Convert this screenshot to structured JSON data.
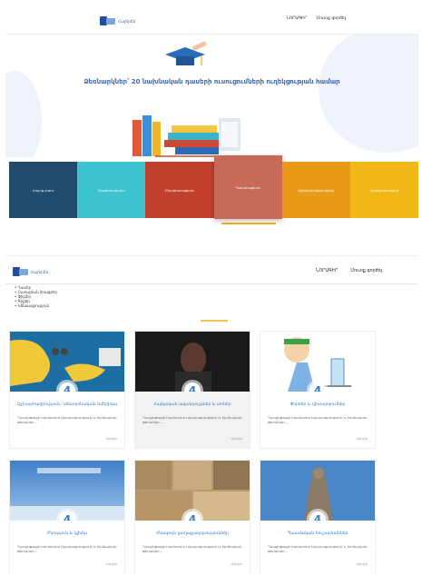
{
  "top": {
    "logo_text": "Հայերեն",
    "nav": [
      "ՆՈՐԱԳԻՐ",
      "Մուտք գործել"
    ],
    "hero_title": "Ձեռնարկներ՝ 20 նախնական դասերի ուսուցումների ուղեկցության համար",
    "categories": [
      {
        "label": "Հայոց լեզու",
        "color": "#1e4b6e"
      },
      {
        "label": "Մաթեմատիկա",
        "color": "#3cc3cf"
      },
      {
        "label": "Բնագիտություն",
        "color": "#c0402b"
      },
      {
        "label": "Պատմություն",
        "color": "#c86a58"
      },
      {
        "label": "Աշխարհագրություն",
        "color": "#e89a18"
      },
      {
        "label": "Գրականություն",
        "color": "#f1b818"
      }
    ]
  },
  "bottom": {
    "logo_text": "Հայերեն",
    "nav": [
      "ՆՈՐԱԳԻՐ",
      "Մուտք գործել"
    ],
    "list": [
      "Դասեր",
      "Ուսուցման ծրագրեր",
      "Ֆիլմեր",
      "Գրքեր",
      "Կենսագրություն"
    ],
    "cards": [
      {
        "title": "Աշխարհագրություն: Կենտրոնական Ամերիկա",
        "desc": "Դասընթացի համառոտ նկարագրություն և հիմնական թեմաներ...",
        "more": "Ավելին",
        "grade": "4"
      },
      {
        "title": "Հայկական ավանդույթներ և տոներ",
        "desc": "Դասընթացի համառոտ նկարագրություն և հիմնական թեմաներ...",
        "more": "Ավելին",
        "grade": "4"
      },
      {
        "title": "Փորձեր և դիտարկումներ",
        "desc": "Դասընթացի համառոտ նկարագրություն և հիմնական թեմաներ...",
        "more": "Ավելին",
        "grade": "4"
      },
      {
        "title": "Բնություն և կլիմա",
        "desc": "Դասընթացի համառոտ նկարագրություն և հիմնական թեմաներ...",
        "more": "Ավելին",
        "grade": "4"
      },
      {
        "title": "Հնագույն քաղաքակրթություններ",
        "desc": "Դասընթացի համառոտ նկարագրություն և հիմնական թեմաներ...",
        "more": "Ավելին",
        "grade": "4"
      },
      {
        "title": "Պատմական հուշարձաններ",
        "desc": "Դասընթացի համառոտ նկարագրություն և հիմնական թեմաներ...",
        "more": "Ավելին",
        "grade": "4"
      }
    ]
  }
}
